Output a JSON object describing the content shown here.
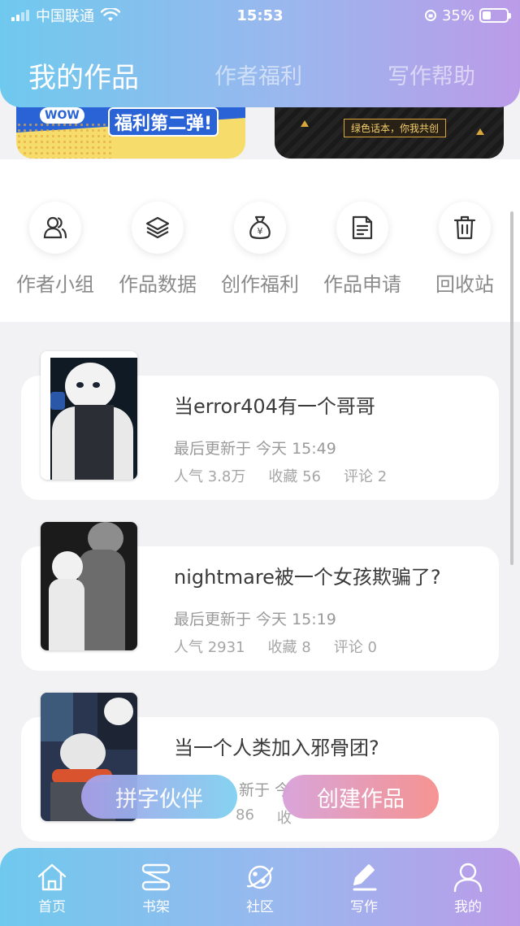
{
  "status_bar": {
    "carrier": "中国联通",
    "time": "15:53",
    "battery": "35%",
    "battery_level": 0.35
  },
  "header": {
    "tabs": [
      {
        "label": "我的作品",
        "active": true
      },
      {
        "label": "作者福利",
        "active": false
      },
      {
        "label": "写作帮助",
        "active": false
      }
    ]
  },
  "banners": {
    "left": {
      "badge": "WOW",
      "text": "福利第二弹!"
    },
    "right": {
      "text": "绿色话本，你我共创"
    }
  },
  "quick_actions": [
    {
      "label": "作者小组",
      "icon": "users-icon"
    },
    {
      "label": "作品数据",
      "icon": "layers-icon"
    },
    {
      "label": "创作福利",
      "icon": "money-bag-icon"
    },
    {
      "label": "作品申请",
      "icon": "document-icon"
    },
    {
      "label": "回收站",
      "icon": "trash-icon"
    }
  ],
  "works": [
    {
      "title": "当error404有一个哥哥",
      "updated": "最后更新于 今天 15:49",
      "popularity": "人气 3.8万",
      "favorites": "收藏 56",
      "comments": "评论 2"
    },
    {
      "title": "nightmare被一个女孩欺骗了?",
      "updated": "最后更新于 今天 15:19",
      "popularity": "人气 2931",
      "favorites": "收藏 8",
      "comments": "评论 0"
    },
    {
      "title": "当一个人类加入邪骨团?",
      "updated": "新于 今",
      "popularity": "86",
      "favorites": "收",
      "comments": ""
    }
  ],
  "floating_buttons": {
    "partner": "拼字伙伴",
    "create": "创建作品"
  },
  "bottom_nav": [
    {
      "label": "首页",
      "icon": "home-icon"
    },
    {
      "label": "书架",
      "icon": "bookshelf-icon"
    },
    {
      "label": "社区",
      "icon": "planet-icon"
    },
    {
      "label": "写作",
      "icon": "pen-icon"
    },
    {
      "label": "我的",
      "icon": "profile-icon"
    }
  ],
  "colors": {
    "gradient_start": "#6fc9ee",
    "gradient_end": "#bb9be8",
    "accent_pink": "#f58e8c"
  }
}
